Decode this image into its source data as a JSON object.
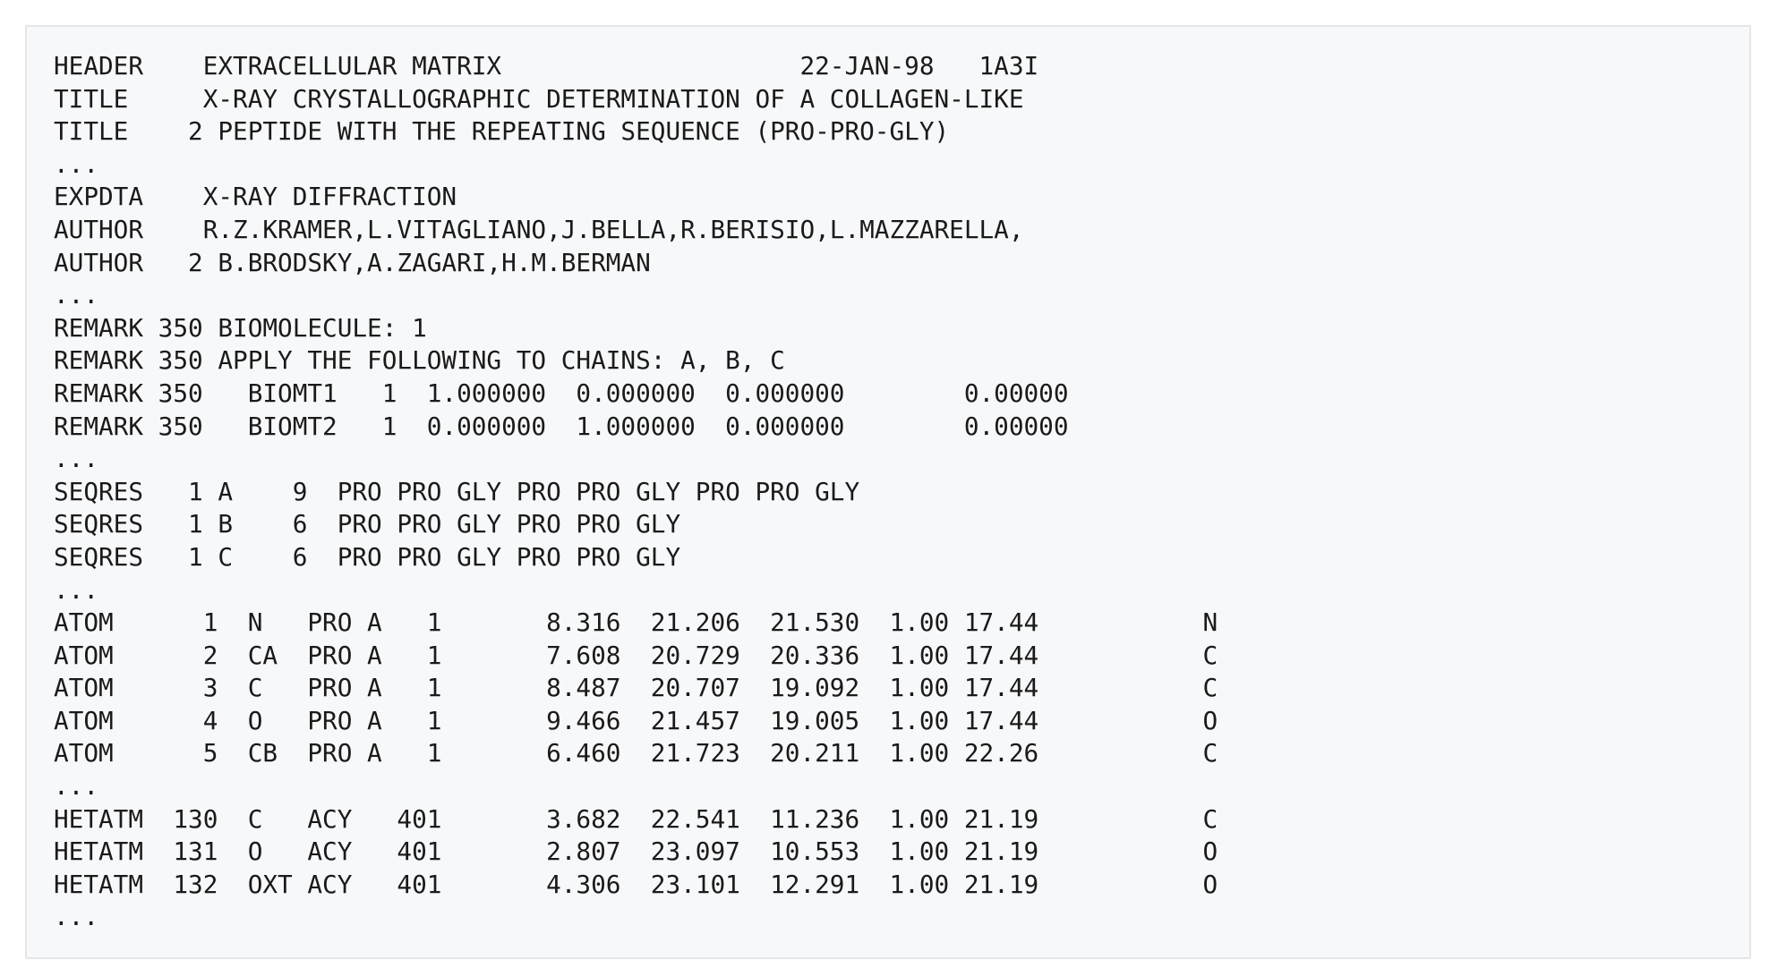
{
  "lines": [
    "HEADER    EXTRACELLULAR MATRIX                    22-JAN-98   1A3I",
    "TITLE     X-RAY CRYSTALLOGRAPHIC DETERMINATION OF A COLLAGEN-LIKE",
    "TITLE    2 PEPTIDE WITH THE REPEATING SEQUENCE (PRO-PRO-GLY)",
    "...",
    "EXPDTA    X-RAY DIFFRACTION",
    "AUTHOR    R.Z.KRAMER,L.VITAGLIANO,J.BELLA,R.BERISIO,L.MAZZARELLA,",
    "AUTHOR   2 B.BRODSKY,A.ZAGARI,H.M.BERMAN",
    "...",
    "REMARK 350 BIOMOLECULE: 1",
    "REMARK 350 APPLY THE FOLLOWING TO CHAINS: A, B, C",
    "REMARK 350   BIOMT1   1  1.000000  0.000000  0.000000        0.00000",
    "REMARK 350   BIOMT2   1  0.000000  1.000000  0.000000        0.00000",
    "...",
    "SEQRES   1 A    9  PRO PRO GLY PRO PRO GLY PRO PRO GLY",
    "SEQRES   1 B    6  PRO PRO GLY PRO PRO GLY",
    "SEQRES   1 C    6  PRO PRO GLY PRO PRO GLY",
    "...",
    "ATOM      1  N   PRO A   1       8.316  21.206  21.530  1.00 17.44           N",
    "ATOM      2  CA  PRO A   1       7.608  20.729  20.336  1.00 17.44           C",
    "ATOM      3  C   PRO A   1       8.487  20.707  19.092  1.00 17.44           C",
    "ATOM      4  O   PRO A   1       9.466  21.457  19.005  1.00 17.44           O",
    "ATOM      5  CB  PRO A   1       6.460  21.723  20.211  1.00 22.26           C",
    "...",
    "HETATM  130  C   ACY   401       3.682  22.541  11.236  1.00 21.19           C",
    "HETATM  131  O   ACY   401       2.807  23.097  10.553  1.00 21.19           O",
    "HETATM  132  OXT ACY   401       4.306  23.101  12.291  1.00 21.19           O",
    "..."
  ]
}
